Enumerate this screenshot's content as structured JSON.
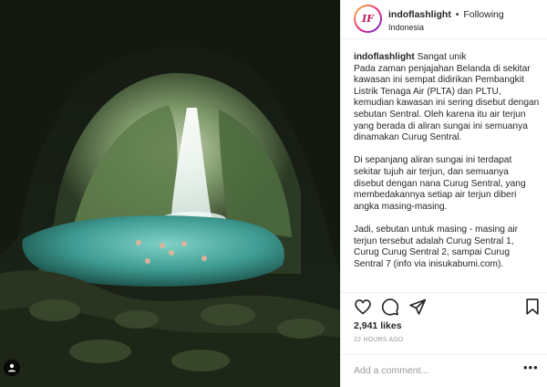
{
  "post": {
    "photo_alt": "",
    "user": {
      "avatar_text": "IF",
      "username": "indoflashlight",
      "separator": "•",
      "follow_status": "Following",
      "location": "Indonesia"
    },
    "caption": {
      "username": "indoflashlight",
      "first_line": "Sangat unik",
      "paragraph_1": "Pada zaman penjajahan Belanda di sekitar kawasan ini sempat didirikan Pembangkit Listrik Tenaga Air (PLTA) dan PLTU, kemudian kawasan ini sering disebut dengan sebutan Sentral. Oleh karena itu air terjun yang berada di aliran sungai ini semuanya dinamakan Curug Sentral.",
      "paragraph_2": "Di sepanjang aliran sungai ini terdapat sekitar tujuh air terjun, dan semuanya disebut dengan nana Curug Sentral, yang membedakannya setiap air terjun diberi angka masing-masing.",
      "paragraph_3": "Jadi, sebutan untuk masing - masing air terjun tersebut adalah Curug Sentral 1, Curug Curug Sentral 2, sampai Curug Sentral 7 (info via inisukabumi.com)."
    },
    "actions": {
      "like_icon": "heart-icon",
      "comment_icon": "speech-bubble-icon",
      "share_icon": "share-icon",
      "save_icon": "bookmark-icon"
    },
    "likes": "2,941 likes",
    "timestamp": "22 HOURS AGO",
    "comment_placeholder": "Add a comment...",
    "more_label": "•••",
    "colors": {
      "text": "#262626",
      "muted": "#999999",
      "border": "#efefef",
      "water": "#3f9c93"
    }
  }
}
